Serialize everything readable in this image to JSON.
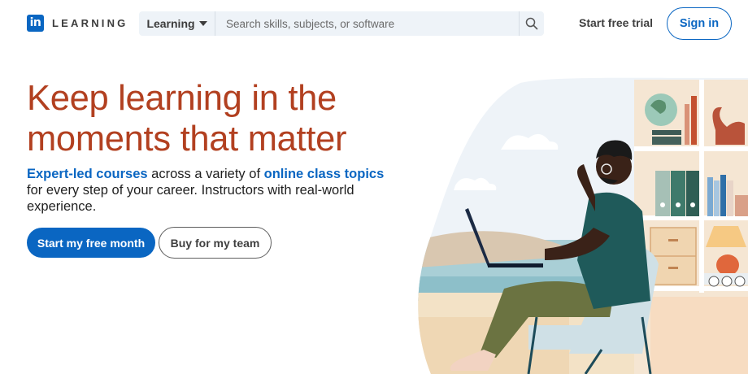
{
  "header": {
    "logo_mark": "in",
    "logo_text": "LEARNING",
    "search": {
      "dropdown_label": "Learning",
      "placeholder": "Search skills, subjects, or software",
      "icon": "search-icon"
    },
    "trial_link": "Start free trial",
    "signin_label": "Sign in"
  },
  "hero": {
    "title_line1": "Keep learning in the",
    "title_line2": "moments that matter",
    "desc_link1": "Expert-led courses",
    "desc_mid": " across a variety of ",
    "desc_link2": "online class topics",
    "desc_rest": " for every step of your career. Instructors with real-world experience.",
    "primary_button": "Start my free month",
    "secondary_button": "Buy for my team"
  },
  "colors": {
    "brand_blue": "#0a66c2",
    "headline": "#b24020",
    "search_bg": "#eef3f8"
  }
}
